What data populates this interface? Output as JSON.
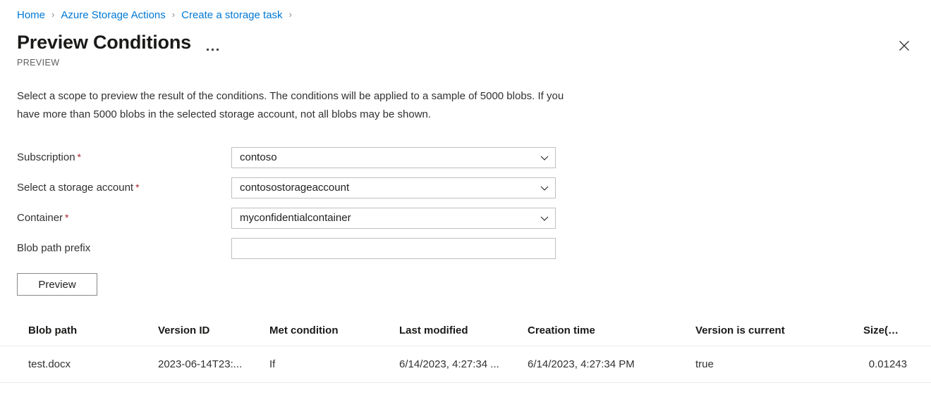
{
  "breadcrumb": {
    "items": [
      {
        "label": "Home"
      },
      {
        "label": "Azure Storage Actions"
      },
      {
        "label": "Create a storage task"
      }
    ],
    "separator": "›"
  },
  "header": {
    "title": "Preview Conditions",
    "preview_tag": "PREVIEW",
    "more_menu_name": "more-options",
    "close_label": "Close"
  },
  "description": "Select a scope to preview the result of the conditions. The conditions will be applied to a sample of 5000 blobs. If you have more than 5000 blobs in the selected storage account, not all blobs may be shown.",
  "form": {
    "subscription": {
      "label": "Subscription",
      "required": "*",
      "value": "contoso"
    },
    "storage_account": {
      "label": "Select a storage account",
      "required": "*",
      "value": "contosostorageaccount"
    },
    "container": {
      "label": "Container",
      "required": "*",
      "value": "myconfidentialcontainer"
    },
    "blob_path_prefix": {
      "label": "Blob path prefix",
      "value": "",
      "placeholder": ""
    },
    "preview_button": "Preview"
  },
  "table": {
    "columns": [
      "Blob path",
      "Version ID",
      "Met condition",
      "Last modified",
      "Creation time",
      "Version is current",
      "Size(MB)"
    ],
    "rows": [
      {
        "blob_path": "test.docx",
        "version_id": "2023-06-14T23:...",
        "met_condition": "If",
        "last_modified": "6/14/2023, 4:27:34 ...",
        "creation_time": "6/14/2023, 4:27:34 PM",
        "version_is_current": "true",
        "size_mb": "0.01243"
      }
    ]
  },
  "colors": {
    "link": "#0078d4",
    "required_star": "#a4262c",
    "text_primary": "#201f1e",
    "text_secondary": "#605e5c",
    "border": "#bfbfbf",
    "rule": "#edebe9"
  }
}
